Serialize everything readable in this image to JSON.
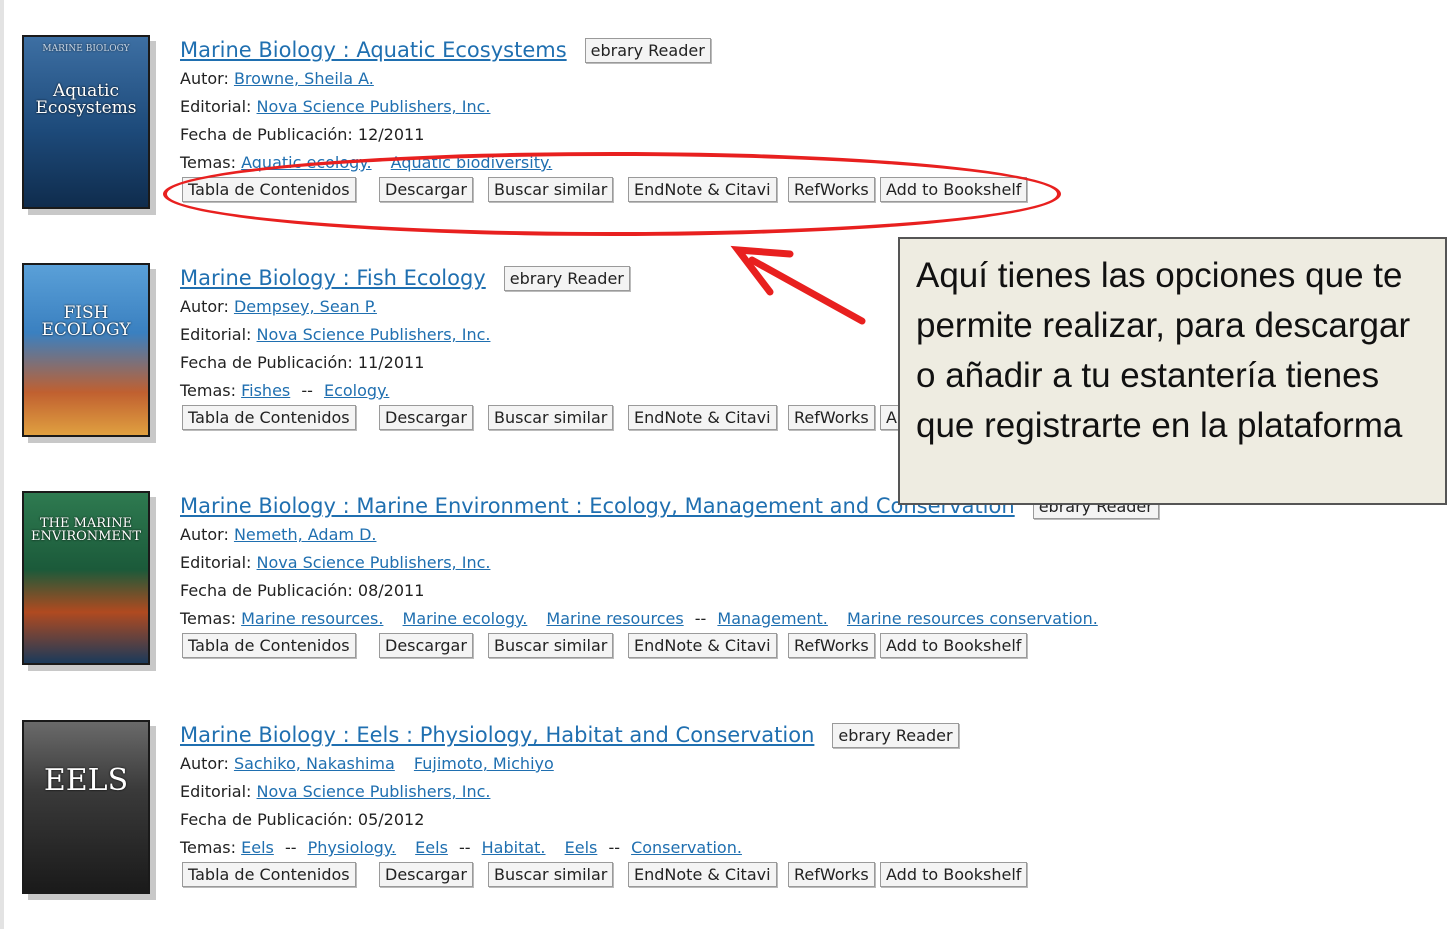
{
  "records": [
    {
      "cover": {
        "title": "Aquatic Ecosystems",
        "bg": "#1d4a7a"
      },
      "title": "Marine Biology : Aquatic Ecosystems",
      "reader": "ebrary Reader",
      "autor_label": "Autor:",
      "autores": [
        "Browne, Sheila A."
      ],
      "editorial_label": "Editorial:",
      "editorial": "Nova Science Publishers, Inc.",
      "fecha_label": "Fecha de Publicación:",
      "fecha": "12/2011",
      "temas_label": "Temas:",
      "temas": [
        "Aquatic ecology.",
        "Aquatic biodiversity."
      ]
    },
    {
      "cover": {
        "title": "FISH ECOLOGY",
        "bg": "#3a80c0"
      },
      "title": "Marine Biology : Fish Ecology",
      "reader": "ebrary Reader",
      "autor_label": "Autor:",
      "autores": [
        "Dempsey, Sean P."
      ],
      "editorial_label": "Editorial:",
      "editorial": "Nova Science Publishers, Inc.",
      "fecha_label": "Fecha de Publicación:",
      "fecha": "11/2011",
      "temas_label": "Temas:",
      "temas_a": "Fishes",
      "temas_sep": "--",
      "temas_b": "Ecology."
    },
    {
      "cover": {
        "title": "THE MARINE ENVIRONMENT",
        "bg": "#1b5a3a"
      },
      "title": "Marine Biology : Marine Environment : Ecology, Management and Conservation",
      "reader": "ebrary Reader",
      "autor_label": "Autor:",
      "autores": [
        "Nemeth, Adam D."
      ],
      "editorial_label": "Editorial:",
      "editorial": "Nova Science Publishers, Inc.",
      "fecha_label": "Fecha de Publicación:",
      "fecha": "08/2011",
      "temas_label": "Temas:",
      "temas": [
        "Marine resources.",
        "Marine ecology.",
        "Marine resources",
        "--",
        "Management.",
        "Marine resources conservation."
      ]
    },
    {
      "cover": {
        "title": "EELS",
        "bg": "#3a3a3a"
      },
      "title": "Marine Biology : Eels : Physiology, Habitat and Conservation",
      "reader": "ebrary Reader",
      "autor_label": "Autor:",
      "autores": [
        "Sachiko, Nakashima",
        "Fujimoto, Michiyo"
      ],
      "editorial_label": "Editorial:",
      "editorial": "Nova Science Publishers, Inc.",
      "fecha_label": "Fecha de Publicación:",
      "fecha": "05/2012",
      "temas_label": "Temas:",
      "temas": [
        "Eels",
        "--",
        "Physiology.",
        "Eels",
        "--",
        "Habitat.",
        "Eels",
        "--",
        "Conservation."
      ]
    }
  ],
  "actions": [
    "Tabla de Contenidos",
    "Descargar",
    "Buscar similar",
    "EndNote & Citavi",
    "RefWorks",
    "Add to Bookshelf"
  ],
  "actions_partial": "A",
  "callout": "Aquí tienes las opciones que te permite realizar, para descargar o añadir a tu estantería tienes que registrarte en la plataforma",
  "colors": {
    "link": "#1f6fb0",
    "highlight": "#e8201f",
    "callout_bg": "#eeece1"
  }
}
